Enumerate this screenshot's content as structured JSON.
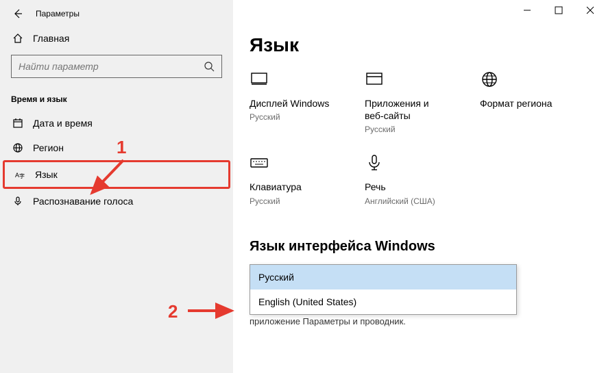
{
  "window": {
    "title": "Параметры"
  },
  "sidebar": {
    "home_label": "Главная",
    "search_placeholder": "Найти параметр",
    "group_title": "Время и язык",
    "items": [
      {
        "label": "Дата и время"
      },
      {
        "label": "Регион"
      },
      {
        "label": "Язык"
      },
      {
        "label": "Распознавание голоса"
      }
    ]
  },
  "page": {
    "title": "Язык",
    "tiles": [
      {
        "label": "Дисплей Windows",
        "sub": "Русский"
      },
      {
        "label": "Приложения и веб-сайты",
        "sub": "Русский"
      },
      {
        "label": "Формат региона",
        "sub": ""
      },
      {
        "label": "Клавиатура",
        "sub": "Русский"
      },
      {
        "label": "Речь",
        "sub": "Английский (США)"
      }
    ],
    "section_title": "Язык интерфейса Windows",
    "dropdown": {
      "options": [
        {
          "label": "Русский",
          "selected": true
        },
        {
          "label": "English (United States)",
          "selected": false
        }
      ]
    },
    "truncated_text": "приложение  Параметры  и проводник."
  },
  "annotations": {
    "num1": "1",
    "num2": "2"
  }
}
